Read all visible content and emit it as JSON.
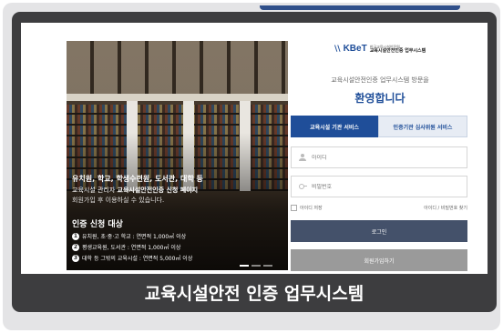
{
  "colors": {
    "accent": "#1f4e99",
    "card_background": "#3d3d3f",
    "login_button": "#44516a",
    "join_button": "#9a9a9a"
  },
  "logo": {
    "mark": "\\\\",
    "text": "KBeT",
    "sub_small": "한국교육시설안전원",
    "sub_big": "교육시설안전인증 업무시스템"
  },
  "hero": {
    "line1": "유치원, 학교, 학생수련원, 도서관, 대학 등",
    "line2_prefix": "교육시설 관리자 ",
    "line2_bold": "교육시설안전인증 신청 페이지",
    "line3": "회원가입 후 이용하실 수 있습니다.",
    "target_title": "인증 신청 대상",
    "targets": [
      {
        "num": "1",
        "text": "유치원, 초·중·고 학교 : 연면적 1,000㎡ 이상"
      },
      {
        "num": "2",
        "text": "평생교육원, 도서관 : 연면적 1,000㎡ 이상"
      },
      {
        "num": "3",
        "text": "대학 등 그밖의 교육시설 : 연면적 5,000㎡ 이상"
      }
    ]
  },
  "panel": {
    "subheading": "교육시설안전인증 업무시스템 방문을",
    "welcome": "환영합니다",
    "tabs": [
      {
        "label": "교육시설 기관 서비스",
        "active": true
      },
      {
        "label": "인증기관 심사위원 서비스",
        "active": false
      }
    ],
    "id_placeholder": "아이디",
    "password_placeholder": "비밀번호",
    "save_id_label": "아이디 저장",
    "find_link": "아이디 / 비밀번호 찾기",
    "login_button": "로그인",
    "join_button": "회원가입하기"
  },
  "caption": "교육시설안전 인증 업무시스템",
  "icons": [
    "person-icon",
    "key-icon",
    "checkbox-icon"
  ]
}
